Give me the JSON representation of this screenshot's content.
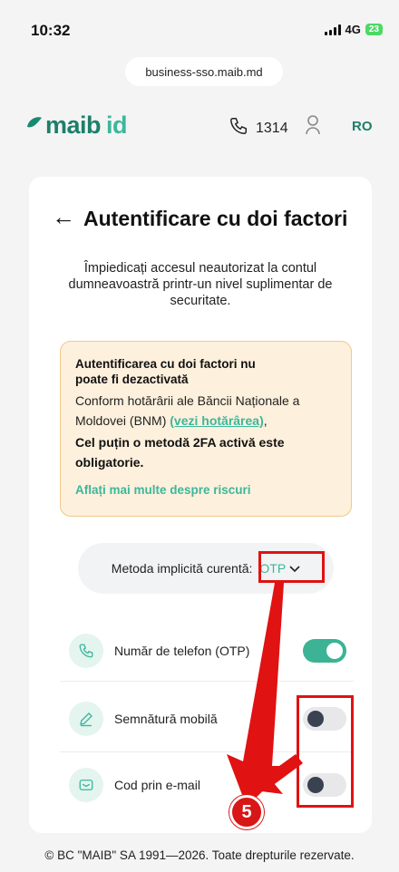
{
  "status_bar": {
    "time": "10:32",
    "network": "4G",
    "battery": "23"
  },
  "browser": {
    "url": "business-sso.maib.md"
  },
  "header": {
    "logo_main": "maib",
    "logo_suffix": "id",
    "phone_number": "1314",
    "language": "RO"
  },
  "page": {
    "title": "Autentificare cu doi factori",
    "subtitle": "Împiedicați accesul neautorizat la contul dumneavoastră printr-un nivel suplimentar de securitate."
  },
  "warning": {
    "title": "Autentificarea cu doi factori nu poate fi dezactivată",
    "text": "Conform hotărârii ale Băncii Naționale a Moldovei (BNM) ",
    "link": "(vezi hotărârea)",
    "bold": "Cel puțin o metodă 2FA activă este obligatorie.",
    "more_link": "Aflați mai multe despre riscuri",
    "background_color": "#fdf0dc",
    "border_color": "#f1c88c"
  },
  "default_method": {
    "label": "Metoda implicită curentă:",
    "value": "OTP"
  },
  "methods": [
    {
      "label": "Număr de telefon (OTP)",
      "icon": "phone-icon",
      "enabled": true
    },
    {
      "label": "Semnătură mobilă",
      "icon": "pen-icon",
      "enabled": false
    },
    {
      "label": "Cod prin e-mail",
      "icon": "envelope-icon",
      "enabled": false
    }
  ],
  "annotation": {
    "step": "5",
    "color": "#e01212"
  },
  "footer": {
    "copyright": "© BC \"MAIB\" SA 1991—2026. Toate drepturile rezervate."
  },
  "colors": {
    "brand": "#1d7f6a",
    "accent": "#3cb79b",
    "toggle_on": "#3bb394"
  }
}
